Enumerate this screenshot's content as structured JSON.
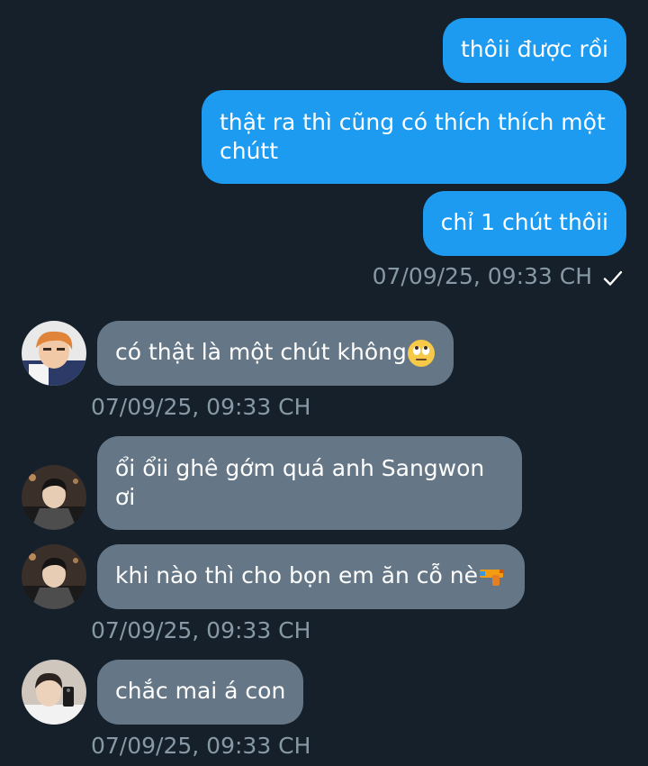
{
  "conversation": {
    "outgoing": [
      {
        "text": "thôii được rồi"
      },
      {
        "text": "thật ra thì cũng có thích thích một chútt"
      },
      {
        "text": "chỉ 1 chút thôii"
      }
    ],
    "outgoing_timestamp": "07/09/25, 09:33 CH",
    "outgoing_status_icon": "check-icon",
    "incoming": [
      {
        "text": "có thật là một chút không",
        "emoji": "rolling-eyes-emoji",
        "avatar": "avatar-orange-hair"
      },
      {
        "text": "ổi ổii ghê gớm quá anh Sangwon ơi",
        "avatar": "avatar-dark-hair"
      },
      {
        "text": "khi nào thì cho bọn em ăn cỗ nè",
        "emoji": "water-gun-emoji",
        "avatar": "avatar-dark-hair"
      },
      {
        "text": "chắc mai á con",
        "avatar": "avatar-mirror-selfie"
      }
    ],
    "incoming_timestamps": [
      "07/09/25, 09:33 CH",
      "07/09/25, 09:33 CH",
      "07/09/25, 09:33 CH"
    ]
  },
  "colors": {
    "background": "#15202b",
    "outgoing_bubble": "#1d9bf0",
    "incoming_bubble": "#657786",
    "timestamp": "#8899a6"
  }
}
